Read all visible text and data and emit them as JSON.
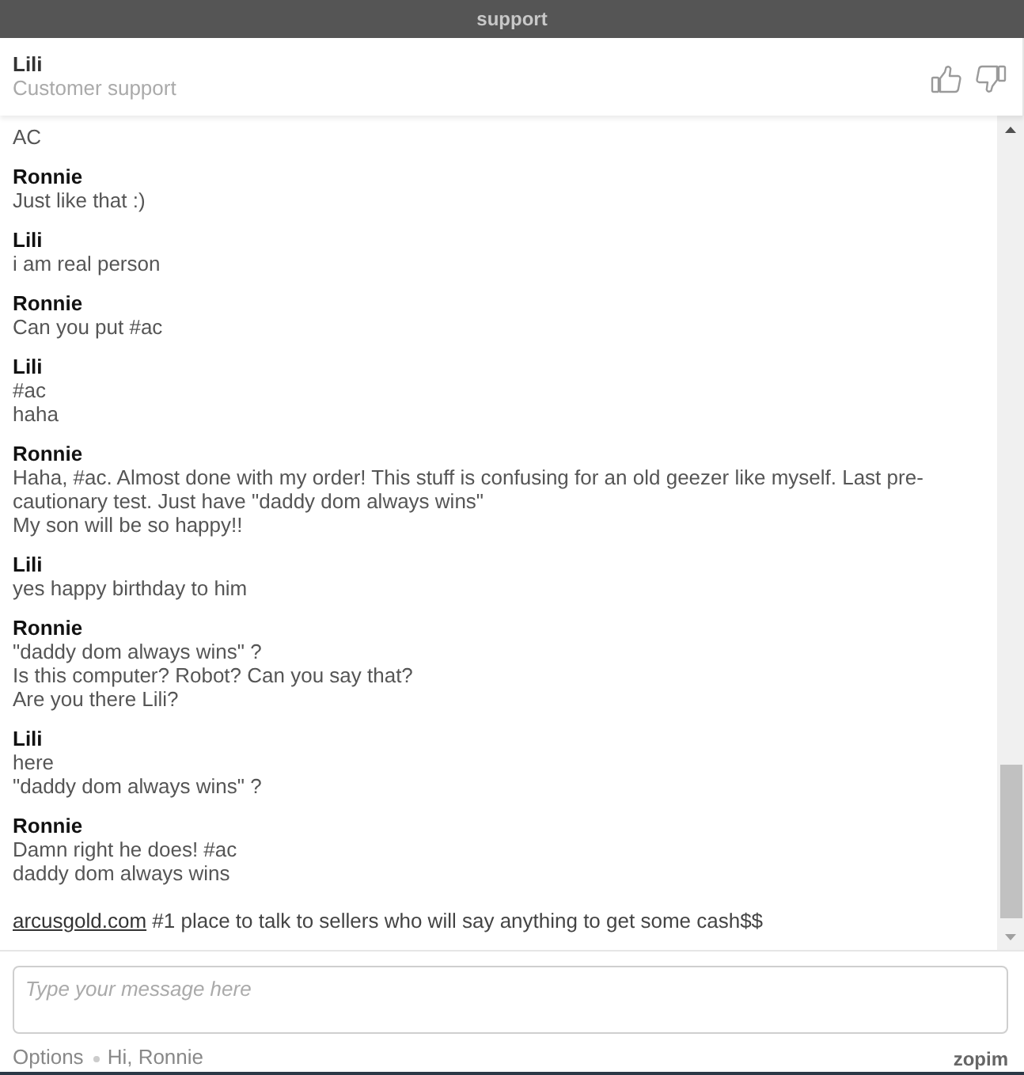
{
  "window": {
    "title": "support"
  },
  "header": {
    "name": "Lili",
    "subtitle": "Customer support"
  },
  "messages": [
    {
      "lines": [
        "AC"
      ]
    },
    {
      "name": "Ronnie",
      "lines": [
        "Just like that :)"
      ]
    },
    {
      "name": "Lili",
      "lines": [
        "i am real person"
      ]
    },
    {
      "name": "Ronnie",
      "lines": [
        "Can you put #ac"
      ]
    },
    {
      "name": "Lili",
      "lines": [
        "#ac",
        "haha"
      ]
    },
    {
      "name": "Ronnie",
      "lines": [
        "Haha, #ac. Almost done with my order! This stuff is confusing for an old geezer like myself. Last pre-cautionary test. Just have \"daddy dom always wins\"",
        "My son will be so happy!!"
      ]
    },
    {
      "name": "Lili",
      "lines": [
        "yes happy birthday to him"
      ]
    },
    {
      "name": "Ronnie",
      "lines": [
        "\"daddy dom always wins\" ?",
        "Is this computer? Robot? Can you say that?",
        "Are you there Lili?"
      ]
    },
    {
      "name": "Lili",
      "lines": [
        "here",
        "\"daddy dom always wins\" ?"
      ]
    },
    {
      "name": "Ronnie",
      "lines": [
        "Damn right he does! #ac",
        "daddy dom always wins"
      ]
    }
  ],
  "promo": {
    "link": "arcusgold.com",
    "text": "#1 place to talk to sellers who will say anything to get some cash$$"
  },
  "composer": {
    "placeholder": "Type your message here"
  },
  "footer": {
    "options": "Options",
    "greeting": "Hi, Ronnie",
    "brand": "zopim"
  }
}
